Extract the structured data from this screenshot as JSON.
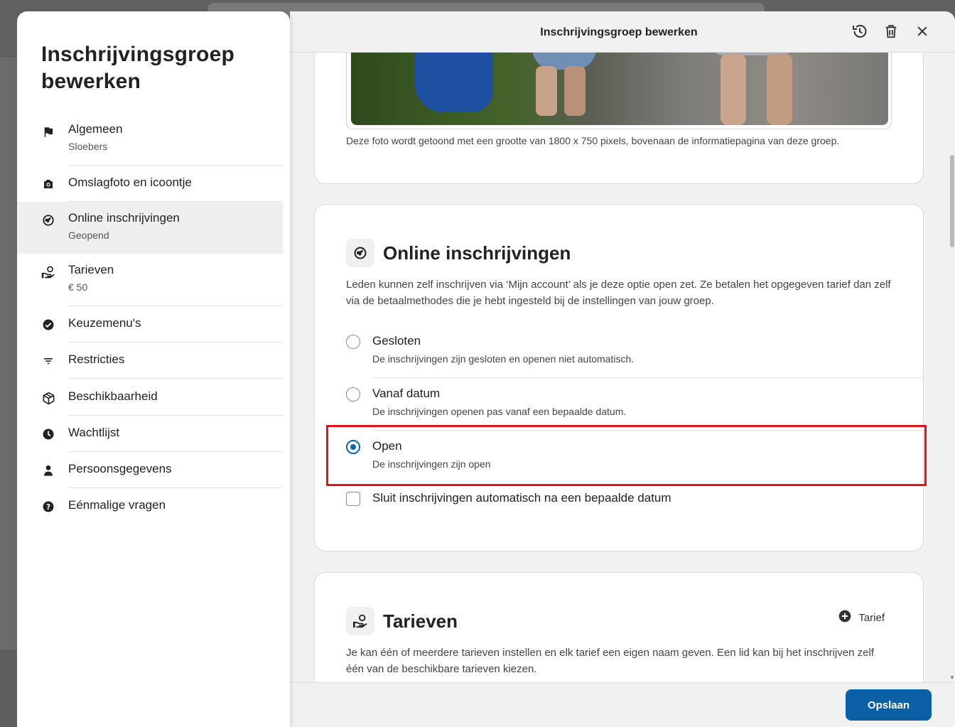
{
  "colors": {
    "accent": "#0b5fa5",
    "highlight": "#e0161f"
  },
  "sidebar": {
    "title": "Inschrijvingsgroep bewerken",
    "items": [
      {
        "label": "Algemeen",
        "sub": "Sloebers",
        "icon": "flag-icon"
      },
      {
        "label": "Omslagfoto en icoontje",
        "sub": "",
        "icon": "camera-icon"
      },
      {
        "label": "Online inschrijvingen",
        "sub": "Geopend",
        "icon": "globe-icon",
        "active": true
      },
      {
        "label": "Tarieven",
        "sub": "€ 50",
        "icon": "hand-coin-icon"
      },
      {
        "label": "Keuzemenu's",
        "sub": "",
        "icon": "check-circle-icon"
      },
      {
        "label": "Restricties",
        "sub": "",
        "icon": "filter-icon"
      },
      {
        "label": "Beschikbaarheid",
        "sub": "",
        "icon": "box-icon"
      },
      {
        "label": "Wachtlijst",
        "sub": "",
        "icon": "clock-icon"
      },
      {
        "label": "Persoonsgegevens",
        "sub": "",
        "icon": "person-icon"
      },
      {
        "label": "Eénmalige vragen",
        "sub": "",
        "icon": "question-icon"
      }
    ]
  },
  "topbar": {
    "title": "Inschrijvingsgroep bewerken",
    "history_icon": "history-icon",
    "delete_icon": "trash-icon",
    "close_icon": "close-icon"
  },
  "photo_card": {
    "caption": "Deze foto wordt getoond met een grootte van 1800 x 750 pixels, bovenaan de informatiepagina van deze groep."
  },
  "online_card": {
    "title": "Online inschrijvingen",
    "description": "Leden kunnen zelf inschrijven via ‘Mijn account’ als je deze optie open zet. Ze betalen het opgegeven tarief dan zelf via de betaalmethodes die je hebt ingesteld bij de instellingen van jouw groep.",
    "options": [
      {
        "label": "Gesloten",
        "sub": "De inschrijvingen zijn gesloten en openen niet automatisch.",
        "checked": false
      },
      {
        "label": "Vanaf datum",
        "sub": "De inschrijvingen openen pas vanaf een bepaalde datum.",
        "checked": false
      },
      {
        "label": "Open",
        "sub": "De inschrijvingen zijn open",
        "checked": true
      }
    ],
    "checkbox_label": "Sluit inschrijvingen automatisch na een bepaalde datum",
    "checkbox_checked": false
  },
  "tarieven_card": {
    "title": "Tarieven",
    "add_label": "Tarief",
    "description": "Je kan één of meerdere tarieven instellen en elk tarief een eigen naam geven. Een lid kan bij het inschrijven zelf één van de beschikbare tarieven kiezen."
  },
  "footer": {
    "save_label": "Opslaan"
  }
}
